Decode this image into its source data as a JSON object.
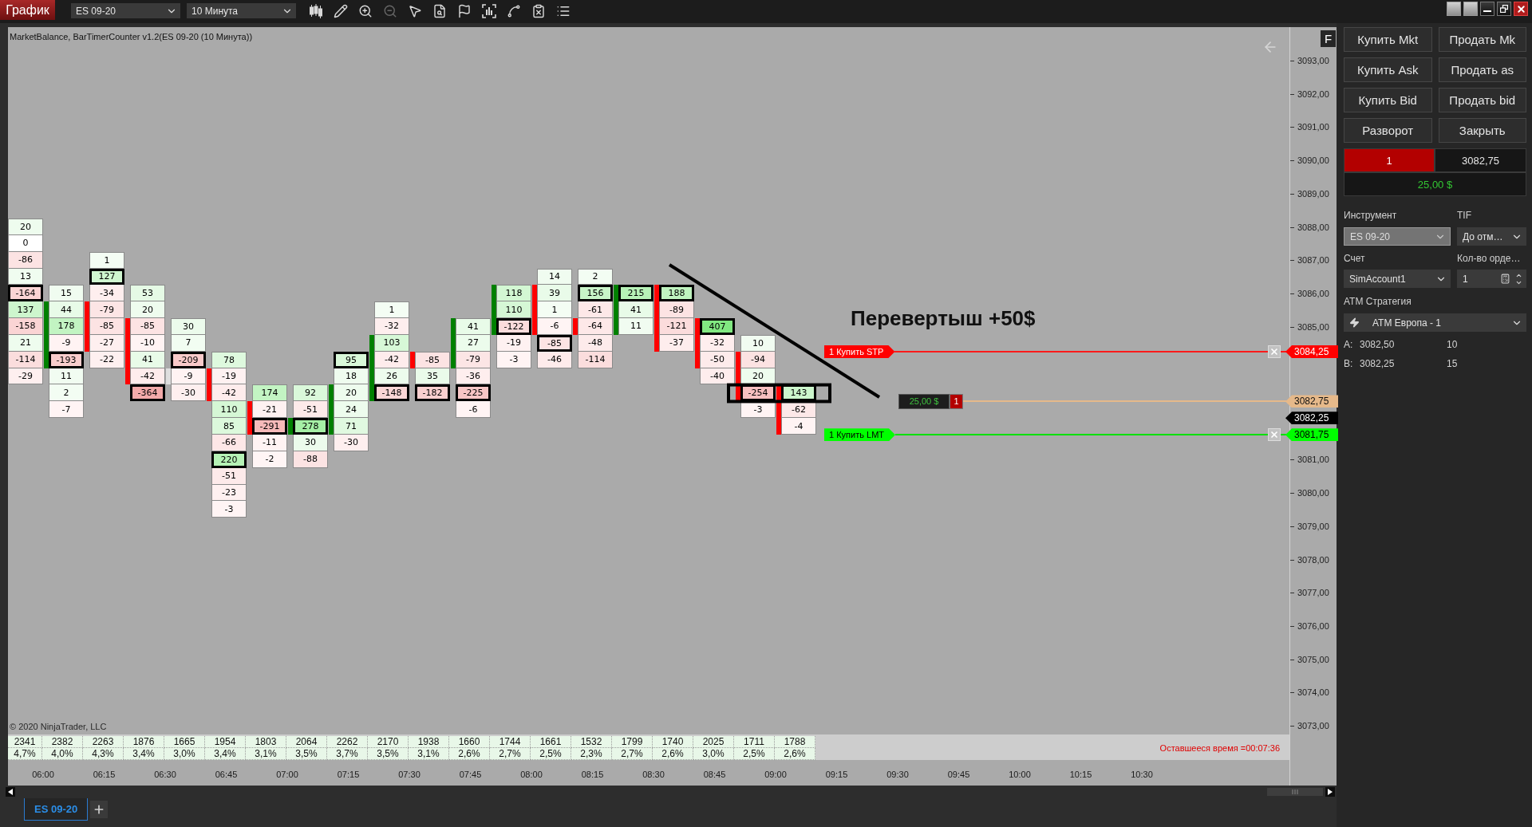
{
  "toolbar": {
    "app_tab": "График",
    "instrument": "ES 09-20",
    "interval": "10 Минута",
    "tools": [
      {
        "kind": "candles",
        "disabled": false
      },
      {
        "kind": "pencil",
        "disabled": false
      },
      {
        "kind": "zoomin",
        "disabled": false
      },
      {
        "kind": "zoomout",
        "disabled": true
      },
      {
        "kind": "pointer",
        "disabled": false
      },
      {
        "kind": "databox",
        "disabled": false
      },
      {
        "kind": "flag",
        "disabled": false
      },
      {
        "kind": "frame",
        "disabled": false
      },
      {
        "kind": "spline",
        "disabled": false
      },
      {
        "kind": "clipboard",
        "disabled": false
      },
      {
        "kind": "list",
        "disabled": false
      }
    ]
  },
  "chart": {
    "title": "MarketBalance, BarTimerCounter v1.2(ES 09-20 (10 Минута))",
    "axis_button": "F",
    "note": "Перевертыш +50$",
    "columns": [
      {
        "cells": [
          {
            "kind": "delta",
            "value": "20",
            "max": false,
            "body": false
          },
          {
            "kind": "delta",
            "value": "0",
            "max": false,
            "body": false
          },
          {
            "kind": "delta",
            "value": "-86",
            "max": false,
            "body": false
          },
          {
            "kind": "delta",
            "value": "13",
            "max": false,
            "body": false
          },
          {
            "kind": "delta",
            "value": "-164",
            "max": true,
            "body": false
          },
          {
            "kind": "delta",
            "value": "137",
            "max": false,
            "body": false
          },
          {
            "kind": "delta",
            "value": "-158",
            "max": false,
            "body": false
          },
          {
            "kind": "delta",
            "value": "21",
            "max": false,
            "body": false
          },
          {
            "kind": "delta",
            "value": "-114",
            "max": false,
            "body": false
          },
          {
            "kind": "delta",
            "value": "-29",
            "max": false,
            "body": false
          }
        ]
      },
      {
        "kind": "up",
        "cells": [
          {
            "kind": "empty"
          },
          {
            "kind": "empty"
          },
          {
            "kind": "empty"
          },
          {
            "kind": "empty"
          },
          {
            "kind": "delta",
            "value": "15",
            "max": false,
            "body": false
          },
          {
            "kind": "delta",
            "value": "44",
            "max": false,
            "body": true
          },
          {
            "kind": "delta",
            "value": "178",
            "max": false,
            "body": true
          },
          {
            "kind": "delta",
            "value": "-9",
            "max": false,
            "body": true
          },
          {
            "kind": "delta",
            "value": "-193",
            "max": true,
            "body": true
          },
          {
            "kind": "delta",
            "value": "11",
            "max": false,
            "body": false
          },
          {
            "kind": "delta",
            "value": "2",
            "max": false,
            "body": false
          },
          {
            "kind": "delta",
            "value": "-7",
            "max": false,
            "body": false
          }
        ]
      },
      {
        "kind": "down",
        "cells": [
          {
            "kind": "empty"
          },
          {
            "kind": "empty"
          },
          {
            "kind": "delta",
            "value": "1",
            "max": false,
            "body": false
          },
          {
            "kind": "delta",
            "value": "127",
            "max": true,
            "body": false
          },
          {
            "kind": "delta",
            "value": "-34",
            "max": false,
            "body": false
          },
          {
            "kind": "delta",
            "value": "-79",
            "max": false,
            "body": true
          },
          {
            "kind": "delta",
            "value": "-85",
            "max": false,
            "body": true
          },
          {
            "kind": "delta",
            "value": "-27",
            "max": false,
            "body": true
          },
          {
            "kind": "delta",
            "value": "-22",
            "max": false,
            "body": false
          }
        ]
      },
      {
        "kind": "down",
        "cells": [
          {
            "kind": "empty"
          },
          {
            "kind": "empty"
          },
          {
            "kind": "empty"
          },
          {
            "kind": "empty"
          },
          {
            "kind": "delta",
            "value": "53",
            "max": false,
            "body": false
          },
          {
            "kind": "delta",
            "value": "20",
            "max": false,
            "body": false
          },
          {
            "kind": "delta",
            "value": "-85",
            "max": false,
            "body": true
          },
          {
            "kind": "delta",
            "value": "-10",
            "max": false,
            "body": true
          },
          {
            "kind": "delta",
            "value": "41",
            "max": false,
            "body": true
          },
          {
            "kind": "delta",
            "value": "-42",
            "max": false,
            "body": true
          },
          {
            "kind": "delta",
            "value": "-364",
            "max": true,
            "body": false
          }
        ]
      },
      {
        "kind": "flat",
        "cells": [
          {
            "kind": "empty"
          },
          {
            "kind": "empty"
          },
          {
            "kind": "empty"
          },
          {
            "kind": "empty"
          },
          {
            "kind": "empty"
          },
          {
            "kind": "empty"
          },
          {
            "kind": "delta",
            "value": "30",
            "max": false,
            "body": false
          },
          {
            "kind": "delta",
            "value": "7",
            "max": false,
            "body": false
          },
          {
            "kind": "delta",
            "value": "-209",
            "max": true,
            "body": false
          },
          {
            "kind": "delta",
            "value": "-9",
            "max": false,
            "body": true
          },
          {
            "kind": "delta",
            "value": "-30",
            "max": false,
            "body": false
          }
        ]
      },
      {
        "kind": "down",
        "cells": [
          {
            "kind": "empty"
          },
          {
            "kind": "empty"
          },
          {
            "kind": "empty"
          },
          {
            "kind": "empty"
          },
          {
            "kind": "empty"
          },
          {
            "kind": "empty"
          },
          {
            "kind": "empty"
          },
          {
            "kind": "empty"
          },
          {
            "kind": "delta",
            "value": "78",
            "max": false,
            "body": false
          },
          {
            "kind": "delta",
            "value": "-19",
            "max": false,
            "body": true
          },
          {
            "kind": "delta",
            "value": "-42",
            "max": false,
            "body": true
          },
          {
            "kind": "delta",
            "value": "110",
            "max": false,
            "body": false
          },
          {
            "kind": "delta",
            "value": "85",
            "max": false,
            "body": false
          },
          {
            "kind": "delta",
            "value": "-66",
            "max": false,
            "body": false
          },
          {
            "kind": "delta",
            "value": "220",
            "max": true,
            "body": false
          },
          {
            "kind": "delta",
            "value": "-51",
            "max": false,
            "body": false
          },
          {
            "kind": "delta",
            "value": "-23",
            "max": false,
            "body": false
          },
          {
            "kind": "delta",
            "value": "-3",
            "max": false,
            "body": false
          }
        ]
      },
      {
        "kind": "down",
        "cells": [
          {
            "kind": "empty"
          },
          {
            "kind": "empty"
          },
          {
            "kind": "empty"
          },
          {
            "kind": "empty"
          },
          {
            "kind": "empty"
          },
          {
            "kind": "empty"
          },
          {
            "kind": "empty"
          },
          {
            "kind": "empty"
          },
          {
            "kind": "empty"
          },
          {
            "kind": "empty"
          },
          {
            "kind": "delta",
            "value": "174",
            "max": false,
            "body": false
          },
          {
            "kind": "delta",
            "value": "-21",
            "max": false,
            "body": true
          },
          {
            "kind": "delta",
            "value": "-291",
            "max": true,
            "body": true
          },
          {
            "kind": "delta",
            "value": "-11",
            "max": false,
            "body": false
          },
          {
            "kind": "delta",
            "value": "-2",
            "max": false,
            "body": false
          }
        ]
      },
      {
        "kind": "up",
        "cells": [
          {
            "kind": "empty"
          },
          {
            "kind": "empty"
          },
          {
            "kind": "empty"
          },
          {
            "kind": "empty"
          },
          {
            "kind": "empty"
          },
          {
            "kind": "empty"
          },
          {
            "kind": "empty"
          },
          {
            "kind": "empty"
          },
          {
            "kind": "empty"
          },
          {
            "kind": "empty"
          },
          {
            "kind": "delta",
            "value": "92",
            "max": false,
            "body": false
          },
          {
            "kind": "delta",
            "value": "-51",
            "max": false,
            "body": false
          },
          {
            "kind": "delta",
            "value": "278",
            "max": true,
            "body": true
          },
          {
            "kind": "delta",
            "value": "30",
            "max": false,
            "body": false
          },
          {
            "kind": "delta",
            "value": "-88",
            "max": false,
            "body": false
          }
        ]
      },
      {
        "kind": "up",
        "cells": [
          {
            "kind": "empty"
          },
          {
            "kind": "empty"
          },
          {
            "kind": "empty"
          },
          {
            "kind": "empty"
          },
          {
            "kind": "empty"
          },
          {
            "kind": "empty"
          },
          {
            "kind": "empty"
          },
          {
            "kind": "empty"
          },
          {
            "kind": "delta",
            "value": "95",
            "max": true,
            "body": false
          },
          {
            "kind": "delta",
            "value": "18",
            "max": false,
            "body": false
          },
          {
            "kind": "delta",
            "value": "20",
            "max": false,
            "body": true
          },
          {
            "kind": "delta",
            "value": "24",
            "max": false,
            "body": true
          },
          {
            "kind": "delta",
            "value": "71",
            "max": false,
            "body": true
          },
          {
            "kind": "delta",
            "value": "-30",
            "max": false,
            "body": false
          }
        ]
      },
      {
        "kind": "up",
        "cells": [
          {
            "kind": "empty"
          },
          {
            "kind": "empty"
          },
          {
            "kind": "empty"
          },
          {
            "kind": "empty"
          },
          {
            "kind": "empty"
          },
          {
            "kind": "delta",
            "value": "1",
            "max": false,
            "body": false
          },
          {
            "kind": "delta",
            "value": "-32",
            "max": false,
            "body": false
          },
          {
            "kind": "delta",
            "value": "103",
            "max": false,
            "body": true
          },
          {
            "kind": "delta",
            "value": "-42",
            "max": false,
            "body": true
          },
          {
            "kind": "delta",
            "value": "26",
            "max": false,
            "body": true
          },
          {
            "kind": "delta",
            "value": "-148",
            "max": true,
            "body": true
          }
        ]
      },
      {
        "kind": "down",
        "cells": [
          {
            "kind": "empty"
          },
          {
            "kind": "empty"
          },
          {
            "kind": "empty"
          },
          {
            "kind": "empty"
          },
          {
            "kind": "empty"
          },
          {
            "kind": "empty"
          },
          {
            "kind": "empty"
          },
          {
            "kind": "empty"
          },
          {
            "kind": "delta",
            "value": "-85",
            "max": false,
            "body": true
          },
          {
            "kind": "delta",
            "value": "35",
            "max": false,
            "body": false
          },
          {
            "kind": "delta",
            "value": "-182",
            "max": true,
            "body": false
          }
        ]
      },
      {
        "kind": "up",
        "cells": [
          {
            "kind": "empty"
          },
          {
            "kind": "empty"
          },
          {
            "kind": "empty"
          },
          {
            "kind": "empty"
          },
          {
            "kind": "empty"
          },
          {
            "kind": "empty"
          },
          {
            "kind": "delta",
            "value": "41",
            "max": false,
            "body": true
          },
          {
            "kind": "delta",
            "value": "27",
            "max": false,
            "body": true
          },
          {
            "kind": "delta",
            "value": "-79",
            "max": false,
            "body": true
          },
          {
            "kind": "delta",
            "value": "-36",
            "max": false,
            "body": false
          },
          {
            "kind": "delta",
            "value": "-225",
            "max": true,
            "body": false
          },
          {
            "kind": "delta",
            "value": "-6",
            "max": false,
            "body": false
          }
        ]
      },
      {
        "kind": "up",
        "cells": [
          {
            "kind": "empty"
          },
          {
            "kind": "empty"
          },
          {
            "kind": "empty"
          },
          {
            "kind": "empty"
          },
          {
            "kind": "delta",
            "value": "118",
            "max": false,
            "body": true
          },
          {
            "kind": "delta",
            "value": "110",
            "max": false,
            "body": true
          },
          {
            "kind": "delta",
            "value": "-122",
            "max": true,
            "body": true
          },
          {
            "kind": "delta",
            "value": "-19",
            "max": false,
            "body": false
          },
          {
            "kind": "delta",
            "value": "-3",
            "max": false,
            "body": false
          }
        ]
      },
      {
        "kind": "down",
        "cells": [
          {
            "kind": "empty"
          },
          {
            "kind": "empty"
          },
          {
            "kind": "empty"
          },
          {
            "kind": "delta",
            "value": "14",
            "max": false,
            "body": false
          },
          {
            "kind": "delta",
            "value": "39",
            "max": false,
            "body": true
          },
          {
            "kind": "delta",
            "value": "1",
            "max": false,
            "body": true
          },
          {
            "kind": "delta",
            "value": "-6",
            "max": false,
            "body": true
          },
          {
            "kind": "delta",
            "value": "-85",
            "max": true,
            "body": false
          },
          {
            "kind": "delta",
            "value": "-46",
            "max": false,
            "body": false
          }
        ]
      },
      {
        "kind": "down",
        "cells": [
          {
            "kind": "empty"
          },
          {
            "kind": "empty"
          },
          {
            "kind": "empty"
          },
          {
            "kind": "delta",
            "value": "2",
            "max": false,
            "body": false
          },
          {
            "kind": "delta",
            "value": "156",
            "max": true,
            "body": false
          },
          {
            "kind": "delta",
            "value": "-61",
            "max": false,
            "body": false
          },
          {
            "kind": "delta",
            "value": "-64",
            "max": false,
            "body": true
          },
          {
            "kind": "delta",
            "value": "-48",
            "max": false,
            "body": false
          },
          {
            "kind": "delta",
            "value": "-114",
            "max": false,
            "body": false
          }
        ]
      },
      {
        "kind": "up",
        "cells": [
          {
            "kind": "empty"
          },
          {
            "kind": "empty"
          },
          {
            "kind": "empty"
          },
          {
            "kind": "empty"
          },
          {
            "kind": "delta",
            "value": "215",
            "max": true,
            "body": true
          },
          {
            "kind": "delta",
            "value": "41",
            "max": false,
            "body": true
          },
          {
            "kind": "delta",
            "value": "11",
            "max": false,
            "body": true
          }
        ]
      },
      {
        "kind": "down",
        "cells": [
          {
            "kind": "empty"
          },
          {
            "kind": "empty"
          },
          {
            "kind": "empty"
          },
          {
            "kind": "empty"
          },
          {
            "kind": "delta",
            "value": "188",
            "max": true,
            "body": true
          },
          {
            "kind": "delta",
            "value": "-89",
            "max": false,
            "body": true
          },
          {
            "kind": "delta",
            "value": "-121",
            "max": false,
            "body": true
          },
          {
            "kind": "delta",
            "value": "-37",
            "max": false,
            "body": true
          }
        ]
      },
      {
        "kind": "down",
        "cells": [
          {
            "kind": "empty"
          },
          {
            "kind": "empty"
          },
          {
            "kind": "empty"
          },
          {
            "kind": "empty"
          },
          {
            "kind": "empty"
          },
          {
            "kind": "empty"
          },
          {
            "kind": "delta",
            "value": "407",
            "max": true,
            "body": true
          },
          {
            "kind": "delta",
            "value": "-32",
            "max": false,
            "body": true
          },
          {
            "kind": "delta",
            "value": "-50",
            "max": false,
            "body": true
          },
          {
            "kind": "delta",
            "value": "-40",
            "max": false,
            "body": false
          }
        ]
      },
      {
        "kind": "down",
        "cells": [
          {
            "kind": "empty"
          },
          {
            "kind": "empty"
          },
          {
            "kind": "empty"
          },
          {
            "kind": "empty"
          },
          {
            "kind": "empty"
          },
          {
            "kind": "empty"
          },
          {
            "kind": "empty"
          },
          {
            "kind": "delta",
            "value": "10",
            "max": false,
            "body": false
          },
          {
            "kind": "delta",
            "value": "-94",
            "max": false,
            "body": true
          },
          {
            "kind": "delta",
            "value": "20",
            "max": false,
            "body": true
          },
          {
            "kind": "delta",
            "value": "-254",
            "max": true,
            "body": true
          },
          {
            "kind": "delta",
            "value": "-3",
            "max": false,
            "body": false
          }
        ]
      },
      {
        "kind": "down",
        "cells": [
          {
            "kind": "empty"
          },
          {
            "kind": "empty"
          },
          {
            "kind": "empty"
          },
          {
            "kind": "empty"
          },
          {
            "kind": "empty"
          },
          {
            "kind": "empty"
          },
          {
            "kind": "empty"
          },
          {
            "kind": "empty"
          },
          {
            "kind": "empty"
          },
          {
            "kind": "empty"
          },
          {
            "kind": "delta",
            "value": "143",
            "max": true,
            "body": true
          },
          {
            "kind": "delta",
            "value": "-62",
            "max": false,
            "body": true
          },
          {
            "kind": "delta",
            "value": "-4",
            "max": false,
            "body": true
          }
        ]
      }
    ],
    "orders": [
      {
        "kind": "stop",
        "label": "1 Купить STP",
        "price": "3084,25"
      },
      {
        "kind": "limit",
        "label": "1 Купить LMT",
        "price": "3081,75"
      }
    ],
    "position": {
      "pnl": "25,00 $",
      "quantity": "1",
      "short": true,
      "price": "3082,75"
    },
    "last_price": "3082,25",
    "price_axis": [
      "3093,00",
      "3092,00",
      "3091,00",
      "3090,00",
      "3089,00",
      "3088,00",
      "3087,00",
      "3086,00",
      "3085,00",
      "3081,00",
      "3080,00",
      "3079,00",
      "3078,00",
      "3077,00",
      "3076,00",
      "3075,00",
      "3074,00",
      "3073,00"
    ],
    "volume": [
      {
        "volume": "2341",
        "share": "4,7%"
      },
      {
        "volume": "2382",
        "share": "4,0%"
      },
      {
        "volume": "2263",
        "share": "4,3%"
      },
      {
        "volume": "1876",
        "share": "3,4%"
      },
      {
        "volume": "1665",
        "share": "3,0%"
      },
      {
        "volume": "1954",
        "share": "3,4%"
      },
      {
        "volume": "1803",
        "share": "3,1%"
      },
      {
        "volume": "2064",
        "share": "3,5%"
      },
      {
        "volume": "2262",
        "share": "3,7%"
      },
      {
        "volume": "2170",
        "share": "3,5%"
      },
      {
        "volume": "1938",
        "share": "3,1%"
      },
      {
        "volume": "1660",
        "share": "2,6%"
      },
      {
        "volume": "1744",
        "share": "2,7%"
      },
      {
        "volume": "1661",
        "share": "2,5%"
      },
      {
        "volume": "1532",
        "share": "2,3%"
      },
      {
        "volume": "1799",
        "share": "2,7%"
      },
      {
        "volume": "1740",
        "share": "2,6%"
      },
      {
        "volume": "2025",
        "share": "3,0%"
      },
      {
        "volume": "1711",
        "share": "2,5%"
      },
      {
        "volume": "1788",
        "share": "2,6%"
      }
    ],
    "remaining_time": "Оставшееся время =00:07:36",
    "copyright": "© 2020 NinjaTrader, LLC",
    "time_axis": [
      "06:00",
      "06:15",
      "06:30",
      "06:45",
      "07:00",
      "07:15",
      "07:30",
      "07:45",
      "08:00",
      "08:15",
      "08:30",
      "08:45",
      "09:00",
      "09:15",
      "09:30",
      "09:45",
      "10:00",
      "10:15",
      "10:30"
    ]
  },
  "tabs": [
    {
      "label": "ES 09-20",
      "selected": true
    }
  ],
  "order_panel": {
    "buttons": [
      "Купить Mkt",
      "Продать Mk",
      "Купить Ask",
      "Продать as",
      "Купить Bid",
      "Продать bid",
      "Разворот",
      "Закрыть"
    ],
    "position": {
      "quantity": "1",
      "short": true,
      "price": "3082,75",
      "pnl": "25,00 $"
    },
    "instrument": {
      "label": "Инструмент",
      "value": "ES 09-20",
      "disabled": true
    },
    "tif": {
      "label": "TIF",
      "value": "До отм…"
    },
    "account": {
      "label": "Счет",
      "value": "SimAccount1"
    },
    "order_quantity": {
      "label": "Кол-во орде…",
      "value": "1"
    },
    "atm_strategy": {
      "label": "ATM Стратегия",
      "value": "ATM Европа - 1"
    },
    "quotes": [
      {
        "side": "A:",
        "price": "3082,50",
        "size": "10"
      },
      {
        "side": "B:",
        "price": "3082,25",
        "size": "15"
      }
    ]
  }
}
